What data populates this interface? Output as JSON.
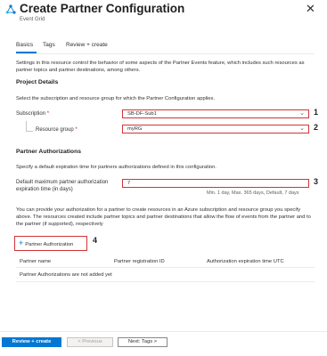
{
  "header": {
    "title": "Create Partner Configuration",
    "subtitle": "Event Grid",
    "close_glyph": "✕"
  },
  "tabs": [
    {
      "label": "Basics",
      "active": true
    },
    {
      "label": "Tags"
    },
    {
      "label": "Review + create"
    }
  ],
  "intro": "Settings in this resource control the behavior of some aspects of the Partner Events feature, which includes such resources as partner topics and partner destinations, among others.",
  "project_details": {
    "heading": "Project Details",
    "description": "Select the subscription and resource group for which the Partner Configuration applies.",
    "subscription": {
      "label": "Subscription",
      "required_mark": "*",
      "value": "SB-DF-Sub1",
      "badge": "1"
    },
    "resource_group": {
      "label": "Resource group",
      "required_mark": "*",
      "value": "myRG",
      "badge": "2"
    }
  },
  "partner_authorizations": {
    "heading": "Partner Authorizations",
    "description": "Specify a default expiration time for partners authorizations defined in this configuration.",
    "expiration": {
      "label_line1": "Default maximum partner authorization",
      "label_line2": "expiration time (in days)",
      "value": "7",
      "hint": "Min. 1 day, Max. 365 days, Default, 7 days",
      "badge": "3"
    },
    "info": "You can provide your authorization for a partner to create resources in an Azure subscription and resource group you specify above. The resources created include partner topics and partner destinations that allow the flow of events from the partner and to the partner (if supported), respectively",
    "add_button": {
      "label": "Partner Authorization",
      "plus": "+",
      "badge": "4"
    },
    "table": {
      "columns": [
        "Partner name",
        "Partner registration ID",
        "Authorization expiration time UTC"
      ],
      "empty_text": "Partner Authorizations are not added yet"
    }
  },
  "footer": {
    "review_create": "Review + create",
    "previous": "< Previous",
    "next": "Next: Tags >"
  },
  "colors": {
    "accent": "#0078d4",
    "highlight": "#d13438"
  }
}
